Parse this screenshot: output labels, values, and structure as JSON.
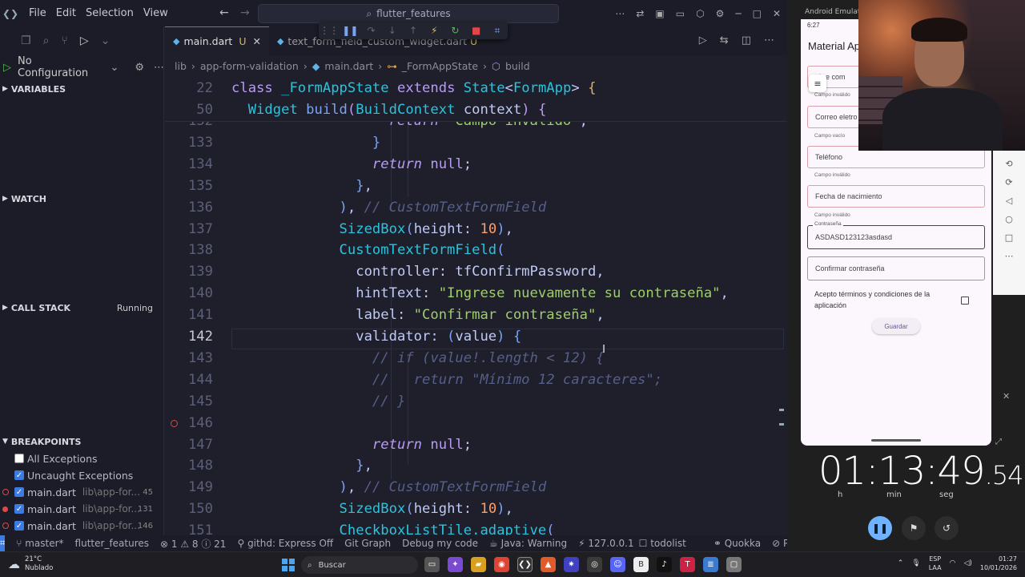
{
  "menu": [
    "File",
    "Edit",
    "Selection",
    "View"
  ],
  "search": {
    "text": "flutter_features"
  },
  "tabs": [
    {
      "label": "main.dart",
      "badge": "U",
      "close": "✕"
    },
    {
      "label": "text_form_field_custom_widget.dart",
      "badge": "U"
    }
  ],
  "breadcrumb": [
    "lib",
    "app-form-validation",
    "main.dart",
    "_FormAppState",
    "build"
  ],
  "sidebar": {
    "run_config": "No Configuration",
    "sections": {
      "variables": "VARIABLES",
      "watch": "WATCH",
      "call_stack": "CALL STACK",
      "call_stack_status": "Running",
      "breakpoints": "BREAKPOINTS"
    },
    "breakpoint_options": [
      "All Exceptions",
      "Uncaught Exceptions"
    ],
    "breakpoints": [
      {
        "file": "main.dart",
        "path": "lib\\app-for...",
        "line": "45"
      },
      {
        "file": "main.dart",
        "path": "lib\\app-for...",
        "line": "131"
      },
      {
        "file": "main.dart",
        "path": "lib\\app-for...",
        "line": "146"
      }
    ]
  },
  "editor": {
    "sticky": [
      {
        "ln": "22",
        "text": "class _FormAppState extends State<FormApp> {"
      },
      {
        "ln": "50",
        "text": "  Widget build(BuildContext context) {"
      }
    ],
    "lines": [
      {
        "ln": "132",
        "text": "                   return \"Campo inválido\";"
      },
      {
        "ln": "133",
        "text": "                 }"
      },
      {
        "ln": "134",
        "text": "                 return null;"
      },
      {
        "ln": "135",
        "text": "               },"
      },
      {
        "ln": "136",
        "text": "             ), // CustomTextFormField"
      },
      {
        "ln": "137",
        "text": "             SizedBox(height: 10),"
      },
      {
        "ln": "138",
        "text": "             CustomTextFormField("
      },
      {
        "ln": "139",
        "text": "               controller: tfConfirmPassword,"
      },
      {
        "ln": "140",
        "text": "               hintText: \"Ingrese nuevamente su contraseña\","
      },
      {
        "ln": "141",
        "text": "               label: \"Confirmar contraseña\","
      },
      {
        "ln": "142",
        "text": "               validator: (value) {"
      },
      {
        "ln": "143",
        "text": "                 // if (value!.length < 12) {"
      },
      {
        "ln": "144",
        "text": "                 //   return \"Mínimo 12 caracteres\";"
      },
      {
        "ln": "145",
        "text": "                 // }"
      },
      {
        "ln": "146",
        "text": ""
      },
      {
        "ln": "147",
        "text": "                 return null;"
      },
      {
        "ln": "148",
        "text": "               },"
      },
      {
        "ln": "149",
        "text": "             ), // CustomTextFormField"
      },
      {
        "ln": "150",
        "text": "             SizedBox(height: 10),"
      },
      {
        "ln": "151",
        "text": "             CheckboxListTile.adaptive("
      }
    ]
  },
  "statusbar": {
    "branch": "master*",
    "project": "flutter_features",
    "problems": "⊗ 1 ⚠ 8 ⓘ 21",
    "githd": "githd: Express Off",
    "gitgraph": "Git Graph",
    "debug": "Debug my code",
    "java": "Java: Warning",
    "host": "127.0.0.1",
    "todolist": "todolist",
    "quokka": "Quokka",
    "prettier": "Pre"
  },
  "emulator": {
    "window_title": "Android Emulator",
    "status_time": "6:27",
    "app_title": "Material Ap",
    "fields": [
      {
        "text": "nbre com",
        "error": "Campo inválido",
        "state": "error"
      },
      {
        "text": "Correo eletro",
        "error": "Campo vacío",
        "state": "error"
      },
      {
        "text": "Teléfono",
        "error": "Campo inválido",
        "state": "error"
      },
      {
        "text": "Fecha de nacimiento",
        "error": "Campo inválido",
        "state": "error"
      },
      {
        "text": "ASDASD123123asdasd",
        "label": "Contraseña",
        "state": "focus"
      },
      {
        "text": "Confirmar contraseña",
        "state": "ok"
      }
    ],
    "terms": "Acepto términos y condiciones de la aplicación",
    "save_button": "Guardar"
  },
  "stopwatch": {
    "time": "01:13:49",
    "ms": ".54",
    "labels": [
      "h",
      "min",
      "seg"
    ]
  },
  "taskbar": {
    "temp": "21°C",
    "weather": "Nublado",
    "search": "Buscar",
    "lang1": "ESP",
    "lang2": "LAA",
    "time": "01:27",
    "date": "10/01/2026"
  }
}
